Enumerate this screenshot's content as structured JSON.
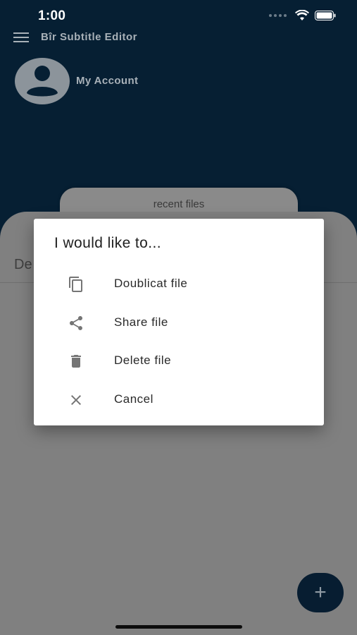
{
  "status_bar": {
    "time": "1:00"
  },
  "header": {
    "app_title": "Bîr Subtitle Editor",
    "account_label": "My Account"
  },
  "recent_tab": {
    "label": "recent files"
  },
  "content": {
    "partial_label": "De"
  },
  "dialog": {
    "title": "I would like to...",
    "options": [
      {
        "label": "Doublicat file",
        "icon": "copy-icon"
      },
      {
        "label": "Share file",
        "icon": "share-icon"
      },
      {
        "label": "Delete file",
        "icon": "trash-icon"
      },
      {
        "label": "Cancel",
        "icon": "close-icon"
      }
    ]
  },
  "fab": {
    "label": "+"
  },
  "colors": {
    "header_bg": "#061f33",
    "fab_bg": "#071d31",
    "dialog_bg": "#ffffff",
    "icon_gray": "#757575"
  }
}
